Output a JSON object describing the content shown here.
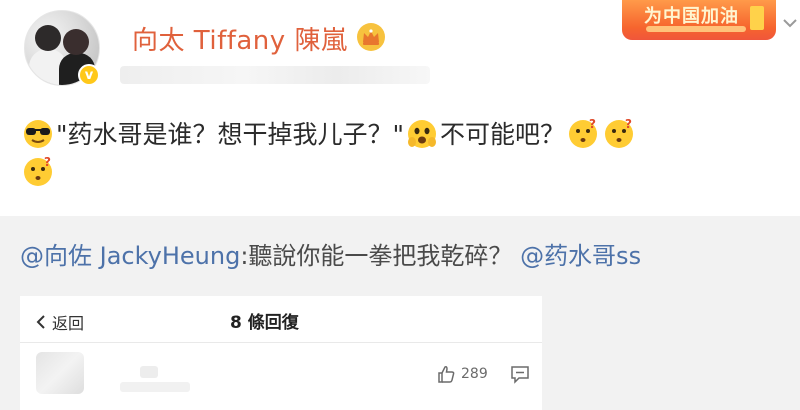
{
  "header": {
    "username": "向太 Tiffany 陳嵐",
    "banner_text": "为中国加油",
    "verified_mark": "v"
  },
  "post": {
    "quote_text": "\"药水哥是谁？想干掉我儿子？\"",
    "tail_text": "不可能吧？"
  },
  "retweet": {
    "mention1": "@向佐 JackyHeung",
    "body": ":聽說你能一拳把我乾碎？",
    "mention2": "@药水哥ss"
  },
  "reply_panel": {
    "back_label": "返回",
    "reply_count_label": "8 條回復",
    "like_count": "289"
  },
  "icons": {
    "verified": "verified-badge-icon",
    "crown": "crown-icon",
    "sunglasses": "sunglasses-emoji-icon",
    "scared": "scared-emoji-icon",
    "thinking": "thinking-emoji-icon",
    "back": "chevron-left-icon",
    "like": "thumbs-up-icon",
    "comment": "comment-icon",
    "menu": "chevron-down-icon"
  },
  "colors": {
    "username": "#e0613c",
    "mention": "#4d72a9",
    "verified": "#ffc81a",
    "banner": "#f6642e"
  }
}
